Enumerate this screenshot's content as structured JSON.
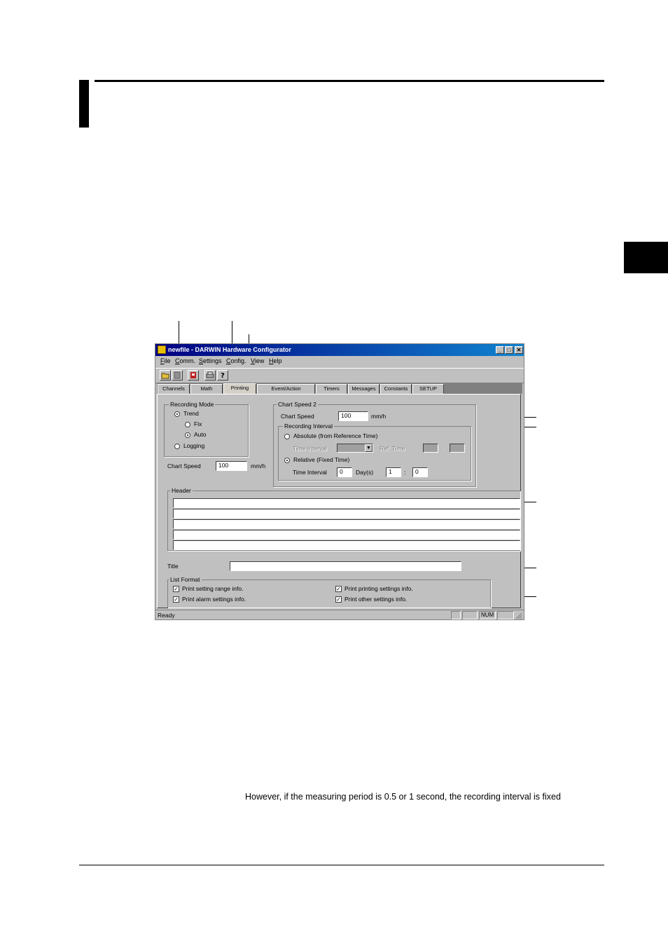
{
  "page_text": {
    "note": "However, if the measuring period is 0.5 or 1 second, the recording interval is fixed"
  },
  "window": {
    "title": "newfile - DARWIN Hardware Configurator",
    "controls": {
      "minimize": "_",
      "maximize": "□",
      "close": "✕"
    },
    "menu": [
      {
        "key": "F",
        "rest": "ile"
      },
      {
        "key": "C",
        "rest": "omm."
      },
      {
        "key": "S",
        "rest": "ettings"
      },
      {
        "key": "C",
        "rest": "onfig."
      },
      {
        "key": "V",
        "rest": "iew"
      },
      {
        "key": "H",
        "rest": "elp"
      }
    ],
    "toolbar_icons": [
      "open-icon",
      "save-icon",
      "upload-icon",
      "print-icon",
      "help-icon"
    ],
    "tabs": [
      "Channels",
      "Math",
      "Printing",
      "Event/Action",
      "Timers",
      "Messages",
      "Constants",
      "SETUP"
    ],
    "active_tab": "Printing"
  },
  "recording_mode": {
    "label": "Recording Mode",
    "trend": "Trend",
    "fix": "Fix",
    "auto": "Auto",
    "logging": "Logging",
    "selected": "Trend",
    "trend_sub_selected": "Auto"
  },
  "chart_speed": {
    "label": "Chart Speed",
    "value": "100",
    "unit": "mm/h"
  },
  "chart_speed_2": {
    "group_label": "Chart Speed 2",
    "label": "Chart Speed",
    "value": "100",
    "unit": "mm/h",
    "recording_interval": {
      "group_label": "Recording Interval",
      "absolute": "Absolute (from Reference Time)",
      "time_interval": "Time Interval",
      "ref_time": "Ref. Time",
      "colon": ":",
      "relative": "Relative (Fixed Time)",
      "rel_time_interval": "Time Interval",
      "days_value": "0",
      "days_label": "Day(s)",
      "hours_value": "1",
      "minutes_value": "0",
      "selected": "Relative (Fixed Time)"
    }
  },
  "header": {
    "label": "Header",
    "lines": [
      "",
      "",
      "",
      "",
      ""
    ]
  },
  "title_field": {
    "label": "Title",
    "value": ""
  },
  "list_format": {
    "label": "List Format",
    "items": [
      {
        "label": "Print setting range info.",
        "checked": true
      },
      {
        "label": "Print printing settings info.",
        "checked": true
      },
      {
        "label": "Print alarm settings info.",
        "checked": true
      },
      {
        "label": "Print other settings info.",
        "checked": true
      }
    ],
    "check_mark": "✓"
  },
  "status_bar": {
    "text": "Ready",
    "num": "NUM"
  }
}
